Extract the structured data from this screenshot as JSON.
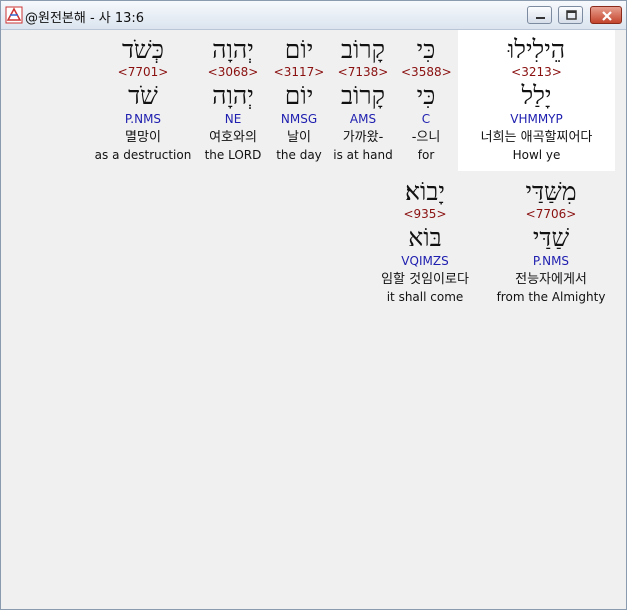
{
  "window": {
    "title": "@원전본해 - 사 13:6"
  },
  "colors": {
    "strongs_number": "#8a1010",
    "grammar_code": "#2020b0",
    "highlight_background": "#ffffff",
    "client_background": "#f0f0f0"
  },
  "words": [
    {
      "hebrew": "הֵילִילוּ",
      "strongs": "<3213>",
      "lemma": "יָלַל",
      "grammar": "VHMMYP",
      "korean": "너희는 애곡할찌어다",
      "english": "Howl ye",
      "selected": true
    },
    {
      "hebrew": "כִּי",
      "strongs": "<3588>",
      "lemma": "כִּי",
      "grammar": "C",
      "korean": "-으니",
      "english": "for",
      "selected": false
    },
    {
      "hebrew": "קָרוֹב",
      "strongs": "<7138>",
      "lemma": "קָרוֹב",
      "grammar": "AMS",
      "korean": "가까왔-",
      "english": "is at hand",
      "selected": false
    },
    {
      "hebrew": "יוֹם",
      "strongs": "<3117>",
      "lemma": "יוֹם",
      "grammar": "NMSG",
      "korean": "날이",
      "english": "the day",
      "selected": false
    },
    {
      "hebrew": "יְהוָה",
      "strongs": "<3068>",
      "lemma": "יְהוָה",
      "grammar": "NE",
      "korean": "여호와의",
      "english": "the LORD",
      "selected": false
    },
    {
      "hebrew": "כְּשֹׁד",
      "strongs": "<7701>",
      "lemma": "שֹׁד",
      "grammar": "P.NMS",
      "korean": "멸망이",
      "english": "as a destruction",
      "selected": false
    },
    {
      "hebrew": "מִשַּׁדַּי",
      "strongs": "<7706>",
      "lemma": "שַׁדַּי",
      "grammar": "P.NMS",
      "korean": "전능자에게서",
      "english": "from the Almighty",
      "selected": false
    },
    {
      "hebrew": "יָבוֹא׃",
      "strongs": "<935>",
      "lemma": "בּוֹא",
      "grammar": "VQIMZS",
      "korean": "임할 것임이로다",
      "english": "it shall come",
      "selected": false
    }
  ]
}
